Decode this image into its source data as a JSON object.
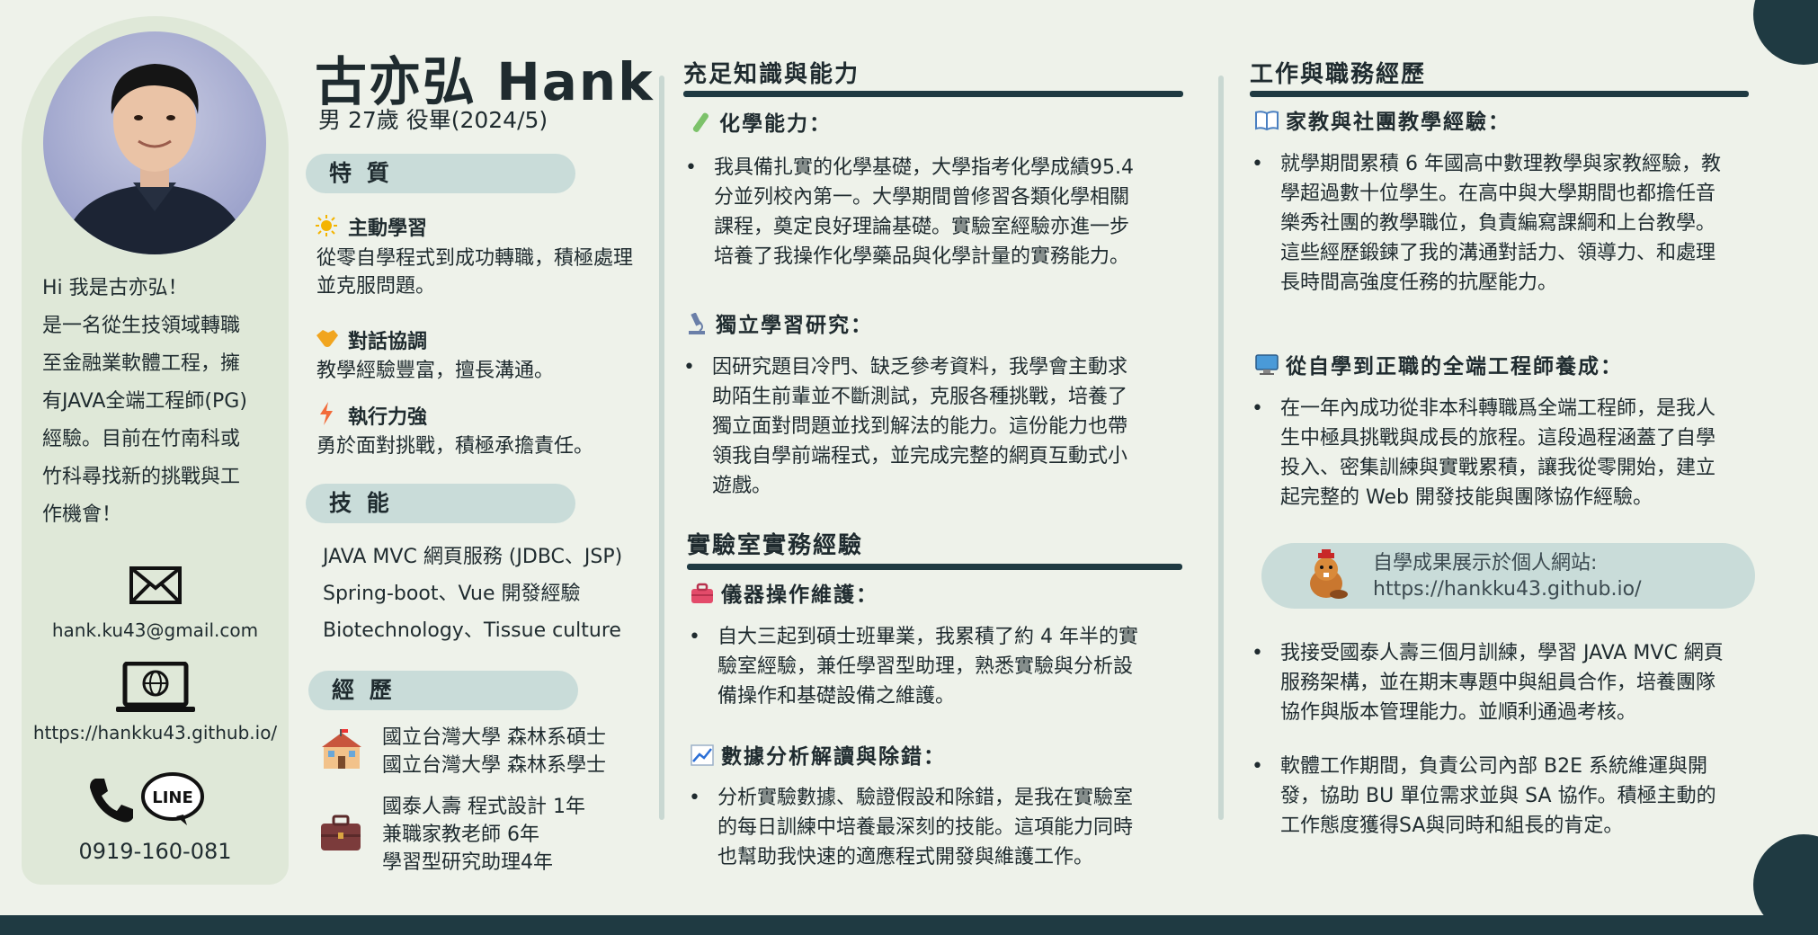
{
  "profile": {
    "name": "古亦弘 Hank",
    "subline": "男 27歲 役畢(2024/5)",
    "intro_lines": [
      "Hi 我是古亦弘！",
      "是一名從生技領域轉職",
      "至金融業軟體工程，擁",
      "有JAVA全端工程師(PG)",
      "經驗。目前在竹南科或",
      "竹科尋找新的挑戰與工",
      "作機會！"
    ],
    "email": "hank.ku43@gmail.com",
    "website": "https://hankku43.github.io/",
    "phone": "0919-160-081",
    "line_label": "LINE"
  },
  "traits": {
    "heading": "特 質",
    "items": [
      {
        "icon": "sun-icon",
        "title": "主動學習",
        "text": "從零自學程式到成功轉職，積極處理並克服問題。"
      },
      {
        "icon": "handshake-icon",
        "title": "對話協調",
        "text": "教學經驗豐富，擅長溝通。"
      },
      {
        "icon": "lightning-icon",
        "title": "執行力強",
        "text": "勇於面對挑戰，積極承擔責任。"
      }
    ]
  },
  "skills": {
    "heading": "技 能",
    "items": [
      "JAVA MVC 網頁服務 (JDBC、JSP)",
      "Spring-boot、Vue 開發經驗",
      "Biotechnology、Tissue culture"
    ]
  },
  "history": {
    "heading": "經 歷",
    "education": [
      "國立台灣大學 森林系碩士",
      "國立台灣大學 森林系學士"
    ],
    "work": [
      "國泰人壽 程式設計 1年",
      "兼職家教老師  6年",
      "學習型研究助理4年"
    ]
  },
  "knowledge": {
    "heading": "充足知識與能力",
    "sections": [
      {
        "icon": "test-tube-icon",
        "title": "化學能力：",
        "lines": [
          "我具備扎實的化學基礎，大學指考化學成績95.4",
          "分並列校內第一。大學期間曾修習各類化學相關",
          "課程，奠定良好理論基礎。實驗室經驗亦進一步",
          "培養了我操作化學藥品與化學計量的實務能力。"
        ]
      },
      {
        "icon": "microscope-icon",
        "title": "獨立學習研究：",
        "lines": [
          "因研究題目冷門、缺乏參考資料，我學會主動求",
          "助陌生前輩並不斷測試，克服各種挑戰，培養了",
          "獨立面對問題並找到解法的能力。這份能力也帶",
          "領我自學前端程式，並完成完整的網頁互動式小",
          "遊戲。"
        ]
      }
    ]
  },
  "lab": {
    "heading": "實驗室實務經驗",
    "sections": [
      {
        "icon": "toolbox-icon",
        "title": "儀器操作維護：",
        "lines": [
          "自大三起到碩士班畢業，我累積了約 4 年半的實",
          "驗室經驗，兼任學習型助理，熟悉實驗與分析設",
          "備操作和基礎設備之維護。"
        ]
      },
      {
        "icon": "chart-icon",
        "title": "數據分析解讀與除錯：",
        "lines": [
          "分析實驗數據、驗證假設和除錯，是我在實驗室",
          "的每日訓練中培養最深刻的技能。這項能力同時",
          "也幫助我快速的適應程式開發與維護工作。"
        ]
      }
    ]
  },
  "work": {
    "heading": "工作與職務經歷",
    "sections": [
      {
        "icon": "book-icon",
        "title": "家教與社團教學經驗：",
        "lines": [
          "就學期間累積 6 年國高中數理教學與家教經驗，教",
          "學超過數十位學生。在高中與大學期間也都擔任音",
          "樂秀社團的教學職位，負責編寫課綱和上台教學。",
          "這些經歷鍛鍊了我的溝通對話力、領導力、和處理",
          "長時間高強度任務的抗壓能力。"
        ]
      },
      {
        "icon": "computer-icon",
        "title": "從自學到正職的全端工程師養成：",
        "lines": [
          "在一年內成功從非本科轉職爲全端工程師，是我人",
          "生中極具挑戰與成長的旅程。這段過程涵蓋了自學",
          "投入、密集訓練與實戰累積，讓我從零開始，建立",
          "起完整的 Web 開發技能與團隊協作經驗。"
        ]
      }
    ],
    "website_label": "自學成果展示於個人網站:",
    "website_url": "https://hankku43.github.io/",
    "bullets2": [
      [
        "我接受國泰人壽三個月訓練，學習 JAVA MVC 網頁",
        "服務架構，並在期末專題中與組員合作，培養團隊",
        "協作與版本管理能力。並順利通過考核。"
      ],
      [
        "軟體工作期間，負責公司內部  B2E  系統維運與開",
        "發，協助 BU 單位需求並與 SA 協作。積極主動的",
        "工作態度獲得SA與同時和組長的肯定。"
      ]
    ]
  },
  "colors": {
    "accent": "#1f3a42",
    "pill": "#c9dcd9",
    "panel": "#dfe8d8",
    "background": "#eef2ea"
  }
}
